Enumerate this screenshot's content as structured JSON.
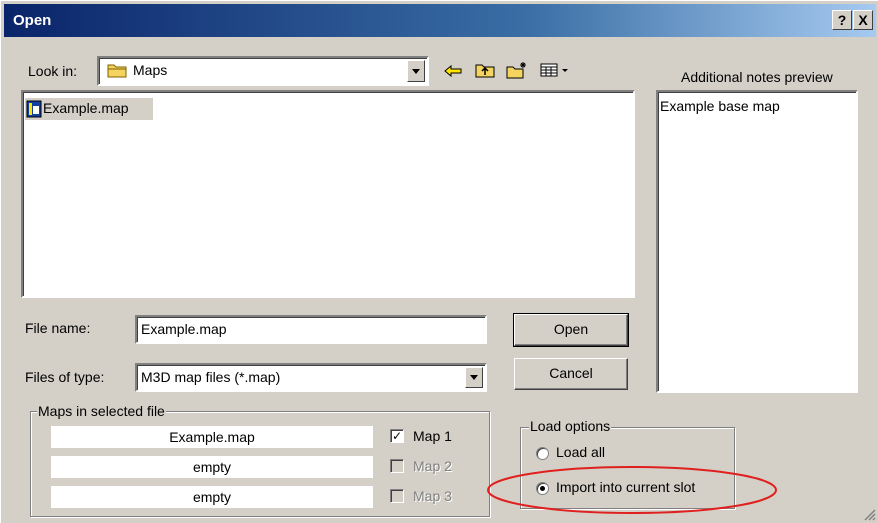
{
  "window": {
    "title": "Open",
    "help_label": "?",
    "close_label": "X"
  },
  "lookin": {
    "label": "Look in:",
    "value": "Maps"
  },
  "toolbar": {
    "icons": [
      "back-arrow-icon",
      "up-folder-icon",
      "new-folder-icon",
      "view-menu-icon"
    ]
  },
  "file_list": {
    "items": [
      {
        "name": "Example.map",
        "selected": true
      }
    ]
  },
  "notes": {
    "label": "Additional notes preview",
    "text": "Example base map"
  },
  "filename": {
    "label": "File name:",
    "value": "Example.map"
  },
  "filetype": {
    "label": "Files of type:",
    "value": "M3D map files (*.map)"
  },
  "buttons": {
    "open": "Open",
    "cancel": "Cancel"
  },
  "maps_group": {
    "title": "Maps in selected file",
    "slots": [
      {
        "name": "Example.map",
        "label": "Map 1",
        "checked": true,
        "enabled": true
      },
      {
        "name": "empty",
        "label": "Map 2",
        "checked": false,
        "enabled": false
      },
      {
        "name": "empty",
        "label": "Map 3",
        "checked": false,
        "enabled": false
      }
    ]
  },
  "load_options": {
    "title": "Load options",
    "options": [
      {
        "label": "Load all",
        "selected": false
      },
      {
        "label": "Import into current slot",
        "selected": true
      }
    ]
  },
  "colors": {
    "title_bar": "#0a246a",
    "face": "#d4d0c8",
    "highlight_ellipse": "#e0201e"
  }
}
